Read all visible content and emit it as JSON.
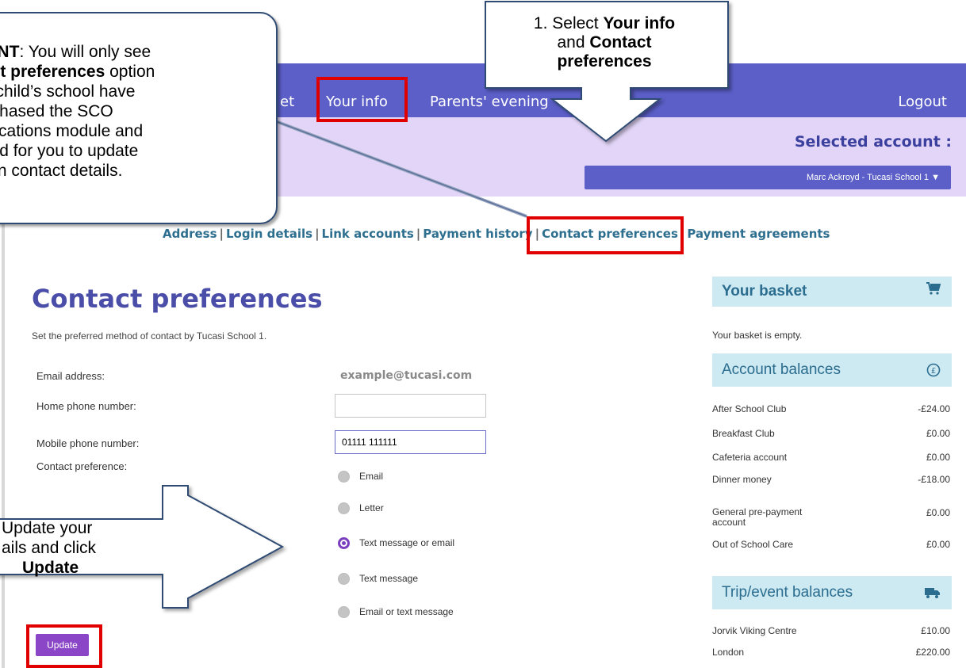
{
  "nav": {
    "items": [
      "et",
      "Your info",
      "Parents' evening"
    ],
    "logout": "Logout"
  },
  "account": {
    "label": "Selected account :",
    "selected": "Marc Ackroyd - Tucasi School 1 ▼"
  },
  "subnav": {
    "items": [
      "Address",
      "Login details",
      "Link accounts",
      "Payment history",
      "Contact preferences",
      "Payment agreements"
    ]
  },
  "page": {
    "title": "Contact preferences",
    "description": "Set the preferred method of contact by Tucasi School 1."
  },
  "form": {
    "email_label": "Email address:",
    "email_value": "example@tucasi.com",
    "home_label": "Home phone number:",
    "home_value": "",
    "mobile_label": "Mobile phone number:",
    "mobile_value": "01111 111111",
    "preference_label": "Contact preference:",
    "options": [
      "Email",
      "Letter",
      "Text message or email",
      "Text message",
      "Email or text message"
    ],
    "selected_option": "Text message or email",
    "update_label": "Update"
  },
  "basket": {
    "title": "Your basket",
    "icon": "cart-icon",
    "empty_text": "Your basket is empty."
  },
  "account_balances": {
    "title": "Account balances",
    "icon": "pound-icon",
    "rows": [
      {
        "name": "After School Club",
        "amount": "-£24.00"
      },
      {
        "name": "Breakfast Club",
        "amount": "£0.00"
      },
      {
        "name": "Cafeteria account",
        "amount": "£0.00"
      },
      {
        "name": "Dinner money",
        "amount": "-£18.00"
      },
      {
        "name": "General pre-payment account",
        "amount": "£0.00"
      },
      {
        "name": "Out of School Care",
        "amount": "£0.00"
      }
    ]
  },
  "trip_balances": {
    "title": "Trip/event balances",
    "icon": "truck-icon",
    "rows": [
      {
        "name": "Jorvik Viking Centre",
        "amount": "£10.00"
      },
      {
        "name": "London",
        "amount": "£220.00"
      }
    ]
  },
  "callouts": {
    "important": "TANT: You will only see\ntact preferences option\nur child’s school have\nurchased the SCO\nunications module and\npted for you to update\nown contact details.",
    "step1_line1": "1. Select ",
    "step1_bold1": "Your info",
    "step1_line2": " and ",
    "step1_bold2": "Contact preferences",
    "step2_line1": "Update your",
    "step2_line2": "ails and click",
    "step2_bold": "Update"
  },
  "colors": {
    "nav": "#5b5fc7",
    "band": "#e2d5f7",
    "panel": "#cde9f2",
    "highlight": "#e00000",
    "button": "#8a46c6"
  }
}
